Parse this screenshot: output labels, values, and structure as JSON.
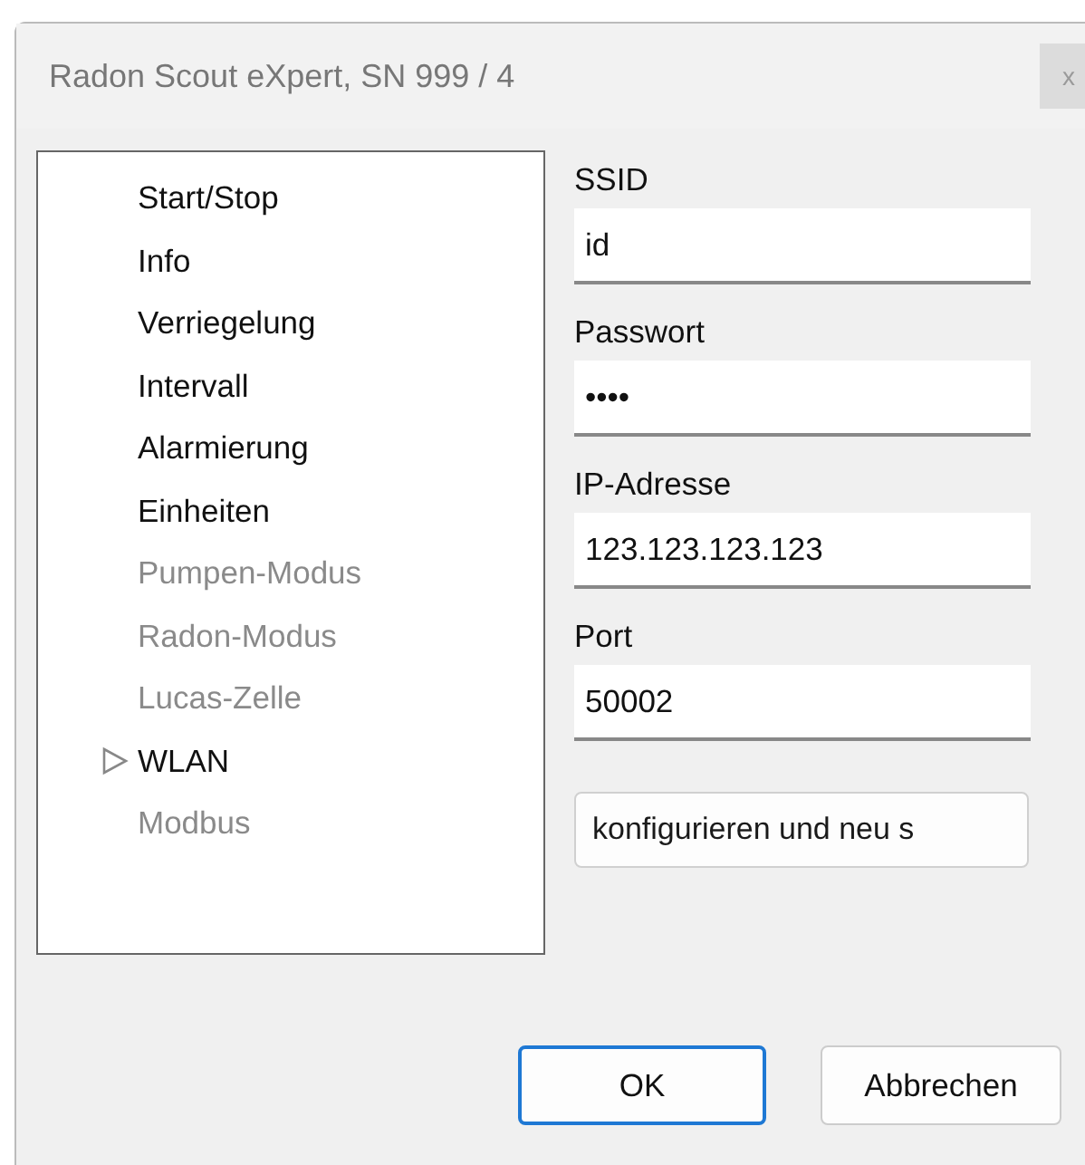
{
  "window": {
    "title": "Radon Scout eXpert, SN 999 / 4",
    "close_button": "x"
  },
  "tree": {
    "items": [
      {
        "label": "Start/Stop",
        "disabled": false,
        "selected": false
      },
      {
        "label": "Info",
        "disabled": false,
        "selected": false
      },
      {
        "label": "Verriegelung",
        "disabled": false,
        "selected": false
      },
      {
        "label": "Intervall",
        "disabled": false,
        "selected": false
      },
      {
        "label": "Alarmierung",
        "disabled": false,
        "selected": false
      },
      {
        "label": "Einheiten",
        "disabled": false,
        "selected": false
      },
      {
        "label": "Pumpen-Modus",
        "disabled": true,
        "selected": false
      },
      {
        "label": "Radon-Modus",
        "disabled": true,
        "selected": false
      },
      {
        "label": "Lucas-Zelle",
        "disabled": true,
        "selected": false
      },
      {
        "label": "WLAN",
        "disabled": false,
        "selected": true
      },
      {
        "label": "Modbus",
        "disabled": true,
        "selected": false
      }
    ]
  },
  "form": {
    "fields": [
      {
        "label": "SSID",
        "value": "id"
      },
      {
        "label": "Passwort",
        "value": "••••"
      },
      {
        "label": "IP-Adresse",
        "value": "123.123.123.123"
      },
      {
        "label": "Port",
        "value": "50002"
      }
    ],
    "action_button": "konfigurieren und neu s"
  },
  "buttons": [
    {
      "label": "OK",
      "default": true
    },
    {
      "label": "Abbrechen",
      "default": false
    }
  ]
}
